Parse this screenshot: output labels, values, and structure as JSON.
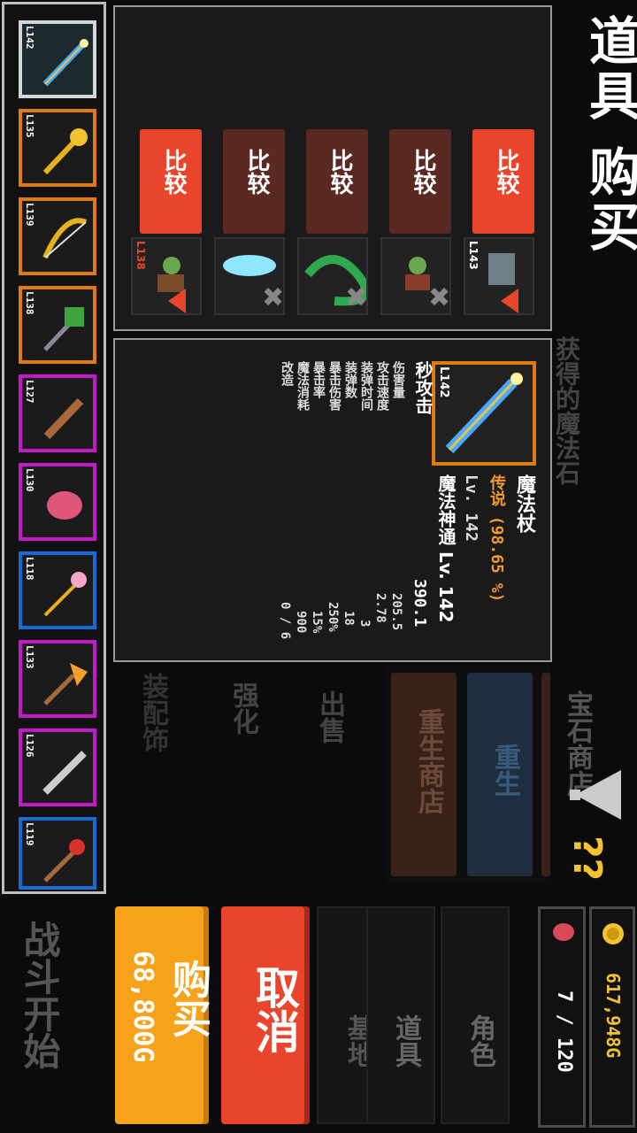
{
  "title": "道具 购买",
  "faint_notice": "获得的魔法石",
  "hint_marks": "??",
  "items": [
    {
      "level": "L142",
      "color": "#e07a12",
      "selected": true,
      "icon": "magic-staff-icon"
    },
    {
      "level": "L135",
      "color": "#e07a12",
      "icon": "golden-mace-icon"
    },
    {
      "level": "L139",
      "color": "#e07a12",
      "icon": "golden-bow-icon"
    },
    {
      "level": "L138",
      "color": "#e07a12",
      "icon": "green-hammer-icon"
    },
    {
      "level": "L127",
      "color": "#c21ac9",
      "icon": "wooden-club-icon"
    },
    {
      "level": "L130",
      "color": "#c21ac9",
      "icon": "pink-gauntlet-icon"
    },
    {
      "level": "L118",
      "color": "#1a6ad6",
      "icon": "pink-wand-icon"
    },
    {
      "level": "L133",
      "color": "#c21ac9",
      "icon": "golden-axe-icon"
    },
    {
      "level": "L126",
      "color": "#c21ac9",
      "icon": "silver-sword-icon"
    },
    {
      "level": "L119",
      "color": "#1a6ad6",
      "icon": "red-scepter-icon"
    }
  ],
  "buy": {
    "label": "购买",
    "price": "68,800G"
  },
  "cancel": {
    "label": "取消"
  },
  "battle_start": "战斗开始",
  "compare": [
    {
      "button": "比较",
      "active": true,
      "level": "L143",
      "icon": "grey-warrior-icon",
      "status": "down"
    },
    {
      "button": "比较",
      "active": false,
      "icon": "goblin-archer-icon",
      "status": "none"
    },
    {
      "button": "比较",
      "active": false,
      "icon": "green-serpent-icon",
      "status": "none"
    },
    {
      "button": "比较",
      "active": false,
      "icon": "ice-blade-icon",
      "status": "none"
    },
    {
      "button": "比较",
      "active": true,
      "level": "L138",
      "icon": "goblin-mage-icon",
      "status": "down"
    }
  ],
  "detail": {
    "level": "L142",
    "name": "魔法杖",
    "rarity": "传说 (98.65 %)",
    "lv": "Lv. 142",
    "skill": "魔法神通 Lv. 142",
    "stats_title": "秒攻击",
    "stats": [
      {
        "label": "秒攻击",
        "value": "390.1"
      },
      {
        "label": "伤害量",
        "value": "205.5"
      },
      {
        "label": "攻击速度",
        "value": "2.78"
      },
      {
        "label": "装弹时间",
        "value": "3"
      },
      {
        "label": "装弹数",
        "value": "18"
      },
      {
        "label": "暴击伤害",
        "value": "250%"
      },
      {
        "label": "暴击率",
        "value": "15%"
      },
      {
        "label": "魔法消耗",
        "value": "900"
      },
      {
        "label": "改造",
        "value": "0 / 6"
      }
    ]
  },
  "menu": [
    "宝石商店",
    "重生",
    "重生商店"
  ],
  "side_menu": [
    "出售",
    "强化",
    "装配饰"
  ],
  "nav": [
    "角色",
    "道具",
    "基地"
  ],
  "gold": "617,948G",
  "capacity": "7 / 120",
  "colors": {
    "orange": "#f6a21a",
    "red": "#e8452c",
    "legend": "#e07a12",
    "epic": "#c21ac9",
    "rare": "#1a6ad6"
  }
}
